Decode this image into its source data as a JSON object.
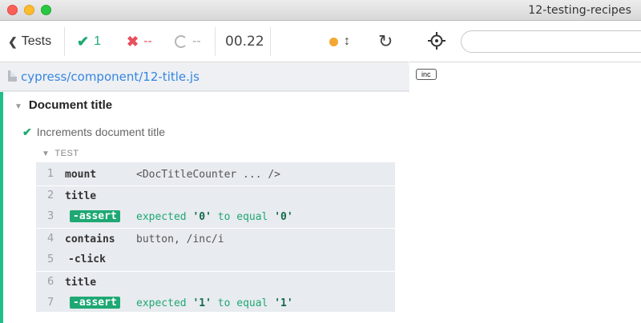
{
  "window": {
    "title": "12-testing-recipes"
  },
  "stats": {
    "tests_label": "Tests",
    "passed": "1",
    "failed": "--",
    "pending": "--",
    "duration": "00.22"
  },
  "spec": {
    "path": "cypress/component/12-title.js"
  },
  "suite": {
    "title": "Document title",
    "test_title": "Increments document title",
    "section_label": "TEST",
    "commands": [
      {
        "num": "1",
        "name": "mount",
        "message": "<DocTitleCounter ... />"
      },
      {
        "num": "2",
        "name": "title",
        "message": ""
      },
      {
        "num": "3",
        "name": "-assert",
        "message_pre": "expected ",
        "value1": "'0'",
        "message_mid": " to equal ",
        "value2": "'0'"
      },
      {
        "num": "4",
        "name": "contains",
        "message": "button, /inc/i"
      },
      {
        "num": "5",
        "name": "-click",
        "message": ""
      },
      {
        "num": "6",
        "name": "title",
        "message": ""
      },
      {
        "num": "7",
        "name": "-assert",
        "message_pre": "expected ",
        "value1": "'1'",
        "message_mid": " to equal ",
        "value2": "'1'"
      }
    ]
  },
  "aut": {
    "button_label": "inc"
  },
  "icons": {
    "back": "chevron-left-icon",
    "pass": "check-icon",
    "fail": "x-icon",
    "pending": "spinner-icon",
    "running": "status-dot-icon",
    "scroll": "up-down-arrow-icon",
    "reload": "reload-icon",
    "selector": "crosshair-icon",
    "file": "file-icon"
  },
  "colors": {
    "pass": "#1fa971",
    "fail": "#e94f5f",
    "accent": "#1fbf86",
    "link": "#3486e0",
    "running": "#f3a732"
  }
}
